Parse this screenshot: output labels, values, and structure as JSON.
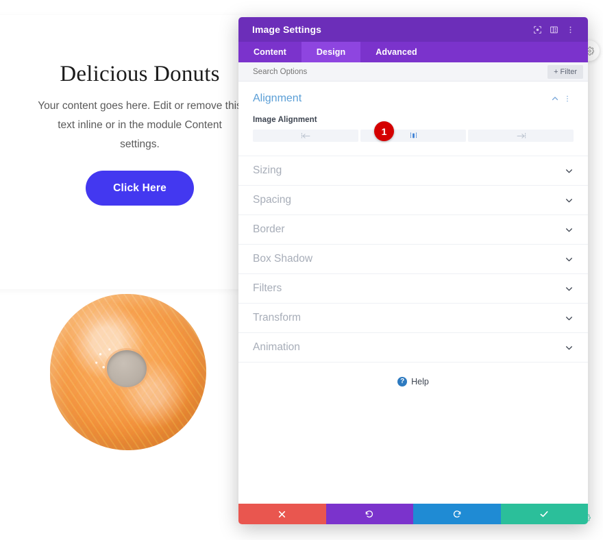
{
  "page": {
    "hero": {
      "title": "Delicious Donuts",
      "body": "Your content goes here. Edit or remove this text inline or in the module Content settings.",
      "button_label": "Click Here",
      "button_color": "#4338f0"
    },
    "image": {
      "alt": "glazed-donut-photo"
    },
    "fabs": [
      {
        "name": "page-settings-fab",
        "icon": "gear-icon"
      },
      {
        "name": "page-save-fab",
        "icon": "gear-icon"
      }
    ]
  },
  "modal": {
    "title": "Image Settings",
    "header_icons": [
      {
        "name": "focus-icon",
        "glyph": "target"
      },
      {
        "name": "layout-columns-icon",
        "glyph": "columns"
      },
      {
        "name": "more-options-icon",
        "glyph": "kebab"
      }
    ],
    "tabs": [
      {
        "label": "Content",
        "active": false
      },
      {
        "label": "Design",
        "active": true
      },
      {
        "label": "Advanced",
        "active": false
      }
    ],
    "search": {
      "placeholder": "Search Options",
      "value": "",
      "filter_label": "+ Filter"
    },
    "alignment": {
      "title": "Alignment",
      "field_label": "Image Alignment",
      "options": [
        {
          "name": "align-left",
          "icon": "align-left-icon",
          "selected": false
        },
        {
          "name": "align-center",
          "icon": "align-center-icon",
          "selected": true
        },
        {
          "name": "align-right",
          "icon": "align-right-icon",
          "selected": false
        }
      ],
      "step_badge": "1",
      "badge_color": "#d40000",
      "collapse_icon": "chevron-up-icon",
      "menu_icon": "kebab-icon"
    },
    "sections": [
      {
        "label": "Sizing"
      },
      {
        "label": "Spacing"
      },
      {
        "label": "Border"
      },
      {
        "label": "Box Shadow"
      },
      {
        "label": "Filters"
      },
      {
        "label": "Transform"
      },
      {
        "label": "Animation"
      }
    ],
    "help": {
      "label": "Help",
      "icon": "question-mark-icon"
    },
    "footer": [
      {
        "name": "cancel-button",
        "icon": "close-icon",
        "color": "#e9564f"
      },
      {
        "name": "undo-button",
        "icon": "undo-icon",
        "color": "#7b33cc"
      },
      {
        "name": "redo-button",
        "icon": "redo-icon",
        "color": "#1f8bd4"
      },
      {
        "name": "save-button",
        "icon": "check-icon",
        "color": "#2bbf9a"
      }
    ],
    "colors": {
      "header": "#6c2eb9",
      "tabbar": "#7b33cc",
      "tab_active": "#8e45e0",
      "section_title": "#5a9ed6"
    }
  }
}
